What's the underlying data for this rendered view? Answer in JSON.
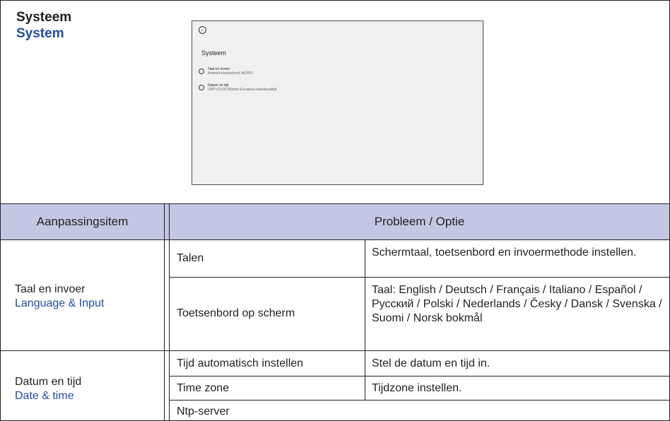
{
  "heading": {
    "nl": "Systeem",
    "en": "System"
  },
  "screenshot": {
    "title": "Systeem",
    "items": [
      {
        "label": "Taal en invoer",
        "sub": "Android-toetsenbord (AOSP)",
        "icon": "globe-icon"
      },
      {
        "label": "Datum en tijd",
        "sub": "GMT+01:00 Midden-Europese standaardtijd",
        "icon": "clock-icon"
      }
    ]
  },
  "table": {
    "headers": {
      "item": "Aanpassingsitem",
      "option": "Probleem / Optie"
    },
    "groups": [
      {
        "label_nl": "Taal en invoer",
        "label_en": "Language & Input",
        "rows": [
          {
            "name": "Talen",
            "desc": "Schermtaal, toetsenbord en invoermethode instellen."
          },
          {
            "name": "Toetsenbord op scherm",
            "desc": "Taal:  English / Deutsch / Français / Italiano / Español / Русский / Polski / Nederlands / Česky / Dansk / Svenska / Suomi / Norsk bokmål"
          }
        ]
      },
      {
        "label_nl": "Datum en tijd",
        "label_en": "Date & time",
        "rows": [
          {
            "name": "Tijd automatisch instellen",
            "desc": "Stel de datum en tijd in."
          },
          {
            "name": "Time zone",
            "desc": "Tijdzone instellen."
          },
          {
            "name": "Ntp-server",
            "desc": ""
          }
        ]
      }
    ]
  },
  "colors": {
    "header_bg": "#c3c7e4",
    "accent_blue": "#1f4ea1",
    "text": "#231f20"
  }
}
